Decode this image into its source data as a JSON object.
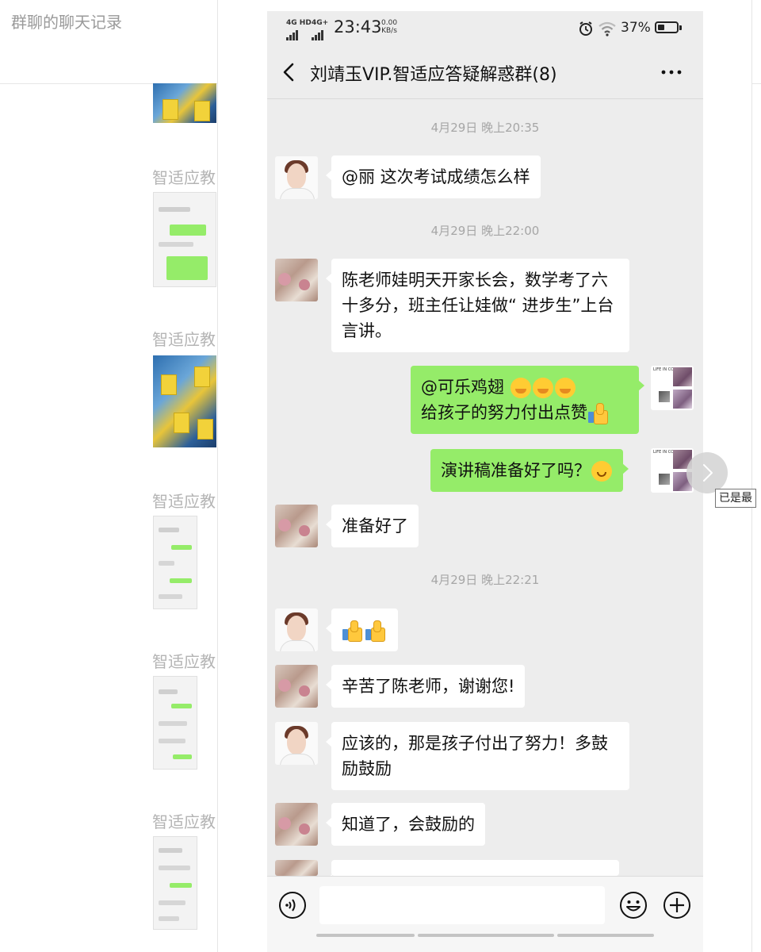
{
  "page": {
    "title": "群聊的聊天记录"
  },
  "history": {
    "sender_names": [
      "智适应教",
      "智适应教",
      "智适应教",
      "智适应教",
      "智适应教"
    ]
  },
  "phone": {
    "status": {
      "network1": "4G HD",
      "network2": "4G+",
      "time": "23:43",
      "speed_value": "0.00",
      "speed_unit": "KB/s",
      "battery": "37%",
      "battery_level": 0.37
    },
    "chat_title": "刘靖玉VIP.智适应答疑解惑群(8)",
    "timestamps": [
      "4月29日 晚上20:35",
      "4月29日 晚上22:00",
      "4月29日 晚上22:21"
    ],
    "messages": [
      {
        "text": "@丽  这次考试成绩怎么样"
      },
      {
        "text": "陈老师娃明天开家长会，数学考了六十多分，班主任让娃做“ 进步生”上台言讲。"
      },
      {
        "line1": "@可乐鸡翅 ",
        "line2": "给孩子的努力付出点赞"
      },
      {
        "text": "演讲稿准备好了吗？"
      },
      {
        "text": "准备好了"
      },
      {
        "text": "辛苦了陈老师，谢谢您!"
      },
      {
        "text": "应该的，那是孩子付出了努力！多鼓励鼓励"
      },
      {
        "text": "知道了，会鼓励的"
      }
    ],
    "my_avatar_caption": "LIFE IN COLOR"
  },
  "viewer": {
    "tooltip": "已是最"
  },
  "icons": [
    "back-arrow-icon",
    "more-dots-icon",
    "voice-icon",
    "emoji-icon",
    "plus-icon",
    "alarm-icon",
    "wifi-icon",
    "next-arrow-icon"
  ],
  "colors": {
    "my_bubble": "#95ec69",
    "their_bubble": "#ffffff",
    "chat_bg": "#ededed"
  }
}
